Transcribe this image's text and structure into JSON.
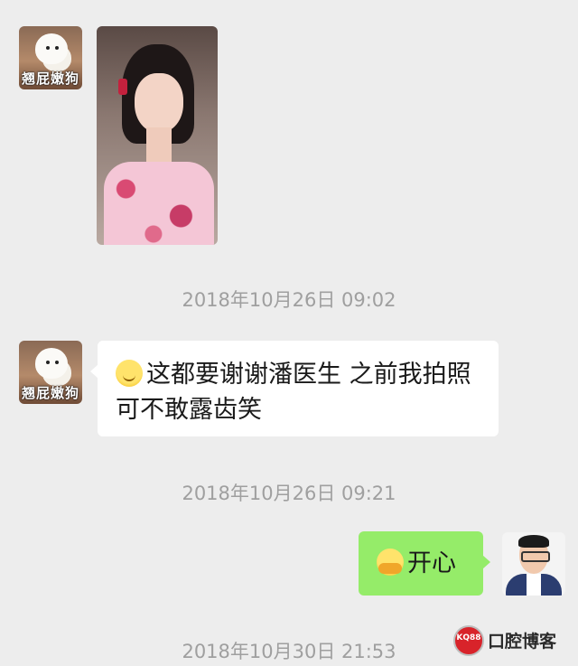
{
  "chat": {
    "contact_label": "翘屁嫩狗",
    "timestamps": [
      "2018年10月26日 09:02",
      "2018年10月26日 09:21",
      "2018年10月30日 21:53"
    ],
    "messages": [
      {
        "from": "contact",
        "type": "image",
        "image_label": "photo of woman in floral dress"
      },
      {
        "from": "contact",
        "type": "text",
        "emoji": "blush-smile-emoji",
        "text": "这都要谢谢潘医生 之前我拍照可不敢露齿笑"
      },
      {
        "from": "me",
        "type": "text",
        "emoji": "hugging-face-emoji",
        "text": "开心"
      }
    ]
  },
  "watermark": {
    "logo_text": "KQ88",
    "name": "口腔博客"
  },
  "colors": {
    "background": "#ededed",
    "incoming_bubble": "#ffffff",
    "outgoing_bubble": "#95ec69",
    "timestamp": "#9f9f9f"
  }
}
